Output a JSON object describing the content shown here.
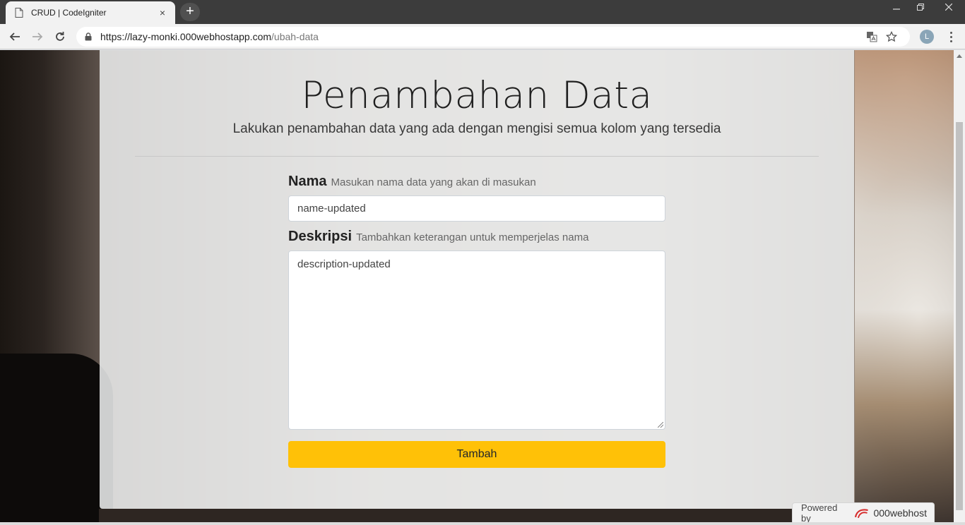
{
  "browser": {
    "tab_title": "CRUD | CodeIgniter",
    "tab_close": "×",
    "new_tab": "+",
    "url_host": "https://lazy-monki.000webhostapp.com",
    "url_path": "/ubah-data",
    "profile_initial": "L",
    "icons": [
      "page-icon",
      "back-icon",
      "forward-icon",
      "reload-icon",
      "lock-icon",
      "translate-icon",
      "star-icon",
      "menu-icon"
    ]
  },
  "page": {
    "title": "Penambahan Data",
    "subtitle": "Lakukan penambahan data yang ada dengan mengisi semua kolom yang tersedia",
    "form": {
      "name_label": "Nama",
      "name_hint": "Masukan nama data yang akan di masukan",
      "name_value": "name-updated",
      "desc_label": "Deskripsi",
      "desc_hint": "Tambahkan keterangan untuk memperjelas nama",
      "desc_value": "description-updated",
      "submit_label": "Tambah"
    },
    "accent_color": "#ffc107"
  },
  "badge": {
    "powered_by": "Powered by",
    "brand": "000webhost"
  }
}
